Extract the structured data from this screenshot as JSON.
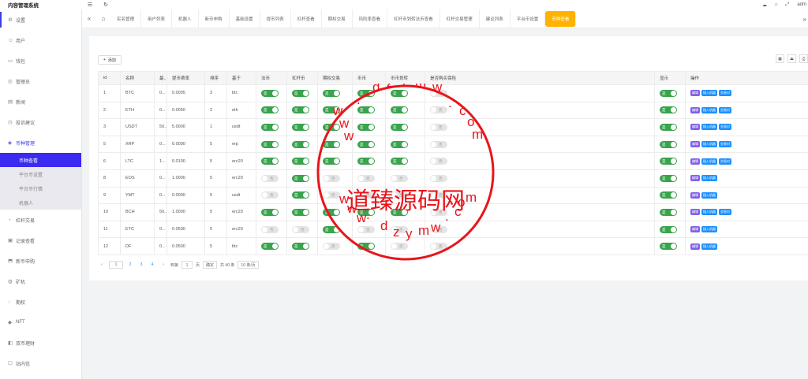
{
  "app": {
    "title": "内容管理系统",
    "user": "adm"
  },
  "topbar": {
    "menu_icon": "menu-icon",
    "refresh_icon": "refresh-icon"
  },
  "sidebar": {
    "items": [
      {
        "label": "设置",
        "icon": "gear-icon"
      },
      {
        "label": "用户",
        "icon": "user-icon"
      },
      {
        "label": "钱包",
        "icon": "wallet-icon"
      },
      {
        "label": "管理员",
        "icon": "admin-icon"
      },
      {
        "label": "新闻",
        "icon": "news-icon"
      },
      {
        "label": "投诉建议",
        "icon": "complaint-icon"
      },
      {
        "label": "币种管理",
        "icon": "coin-icon"
      }
    ],
    "subitems": [
      {
        "label": "币种查看"
      },
      {
        "label": "平台币设置"
      },
      {
        "label": "平台币行情"
      },
      {
        "label": "机器人"
      }
    ],
    "items_after": [
      {
        "label": "杠杆交易"
      },
      {
        "label": "记录查看"
      },
      {
        "label": "新币申购"
      },
      {
        "label": "矿机"
      },
      {
        "label": "期权"
      },
      {
        "label": "NFT"
      },
      {
        "label": "双币理财"
      },
      {
        "label": "站内信"
      }
    ]
  },
  "tabs": [
    "实名管理",
    "用户列表",
    "机器人",
    "新币申购",
    "基础设置",
    "提币列表",
    "杠杆查看",
    "期权交易",
    "风险率查看",
    "杠杆币划转法币查看",
    "杠杆交易管理",
    "建议列表",
    "平台币设置",
    "币种查看"
  ],
  "toolbar": {
    "add_label": "添加"
  },
  "table": {
    "headers": [
      "id",
      "名称",
      "最...",
      "提币费率",
      "排序",
      "基于",
      "法币",
      "杠杆币",
      "期权交易",
      "币币",
      "币币划转",
      "是否购买保险",
      "显示",
      "操作"
    ],
    "on_label": "是",
    "off_label": "否",
    "op_labels": {
      "edit": "编辑",
      "robot": "插入机器",
      "trade": "交易对"
    },
    "rows": [
      {
        "id": "1",
        "name": "BTC",
        "min": "0...",
        "fee": "0.0005",
        "sort": "3",
        "base": "btc",
        "s": [
          1,
          1,
          1,
          1,
          1,
          0,
          1
        ],
        "ops": 3
      },
      {
        "id": "2",
        "name": "ETH",
        "min": "0...",
        "fee": "0.0050",
        "sort": "2",
        "base": "eth",
        "s": [
          1,
          1,
          1,
          1,
          1,
          0,
          1
        ],
        "ops": 3
      },
      {
        "id": "3",
        "name": "USDT",
        "min": "50...",
        "fee": "5.0000",
        "sort": "1",
        "base": "usdt",
        "s": [
          1,
          1,
          1,
          1,
          1,
          0,
          1
        ],
        "ops": 3
      },
      {
        "id": "5",
        "name": "XRP",
        "min": "0...",
        "fee": "0.0000",
        "sort": "5",
        "base": "erp",
        "s": [
          1,
          1,
          1,
          1,
          1,
          0,
          1
        ],
        "ops": 3
      },
      {
        "id": "6",
        "name": "LTC",
        "min": "1...",
        "fee": "0.0100",
        "sort": "5",
        "base": "erc20",
        "s": [
          1,
          1,
          1,
          1,
          1,
          0,
          1
        ],
        "ops": 3
      },
      {
        "id": "8",
        "name": "EOS",
        "min": "0...",
        "fee": "1.0000",
        "sort": "5",
        "base": "erc20",
        "s": [
          0,
          1,
          0,
          0,
          0,
          0,
          1
        ],
        "ops": 2
      },
      {
        "id": "9",
        "name": "YMT",
        "min": "0...",
        "fee": "0.0000",
        "sort": "5",
        "base": "usdt",
        "s": [
          0,
          1,
          0,
          0,
          0,
          0,
          1
        ],
        "ops": 2
      },
      {
        "id": "10",
        "name": "BCH",
        "min": "50...",
        "fee": "1.0000",
        "sort": "5",
        "base": "erc20",
        "s": [
          1,
          1,
          1,
          1,
          1,
          0,
          1
        ],
        "ops": 3
      },
      {
        "id": "11",
        "name": "ETC",
        "min": "0...",
        "fee": "0.0500",
        "sort": "5",
        "base": "erc20",
        "s": [
          0,
          0,
          1,
          0,
          0,
          0,
          1
        ],
        "ops": 2
      },
      {
        "id": "12",
        "name": "DF",
        "min": "0...",
        "fee": "0.0500",
        "sort": "5",
        "base": "btc",
        "s": [
          1,
          1,
          0,
          1,
          0,
          0,
          1
        ],
        "ops": 2
      }
    ]
  },
  "pager": {
    "pages": [
      "1",
      "2",
      "3",
      "4"
    ],
    "goto_label": "到第",
    "page_input": "1",
    "page_unit": "页",
    "confirm_label": "确定",
    "total_label": "共 40 条",
    "size_label": "10 条/页"
  },
  "watermark": {
    "main": "道臻源码网",
    "top_chars": [
      "w",
      "w",
      "w",
      ".",
      "d",
      "z",
      "y",
      "m",
      "w",
      ".",
      "c",
      "o",
      "m"
    ],
    "bottom_chars": [
      "w",
      "w",
      "w",
      ".",
      "d",
      "z",
      "y",
      "m",
      "w",
      ".",
      "c",
      "o",
      "m"
    ],
    "color": "#e8151b"
  },
  "colors": {
    "accent": "#3b2bf0",
    "switch_on": "#3aa34d",
    "active_tab": "#ffb300",
    "op_edit": "#8061e8",
    "op_blue": "#1e90ff"
  }
}
